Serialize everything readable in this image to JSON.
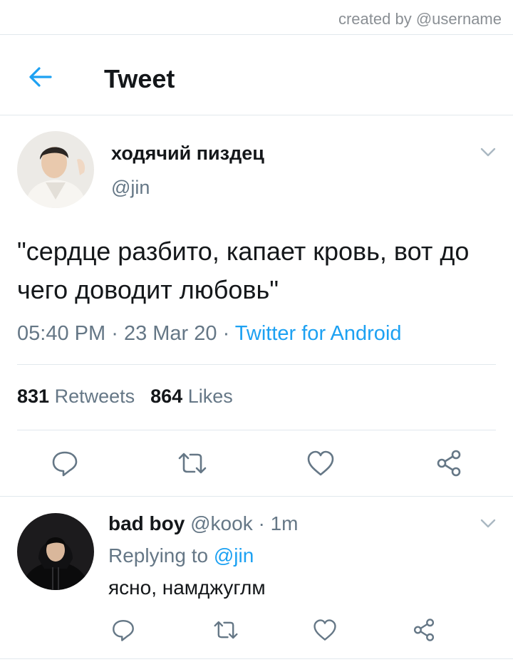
{
  "watermark": "created by @username",
  "header": {
    "title": "Tweet",
    "back_icon": "arrow-left-icon"
  },
  "tweet": {
    "author": {
      "name": "ходячий пиздец",
      "handle": "@jin"
    },
    "text": "\"сердце разбито, капает кровь, вот до чего доводит любовь\"",
    "time": "05:40 PM",
    "date": "23 Mar 20",
    "separator": "·",
    "source": "Twitter for Android",
    "stats": {
      "retweets_count": "831",
      "retweets_label": "Retweets",
      "likes_count": "864",
      "likes_label": "Likes"
    }
  },
  "reply": {
    "author": {
      "name": "bad boy",
      "handle": "@kook"
    },
    "time": "1m",
    "separator": "·",
    "replying_label": "Replying to",
    "replying_handle": "@jin",
    "text": "ясно, намджуглм"
  },
  "colors": {
    "accent": "#1da1f2",
    "muted": "#657786",
    "text": "#14171a",
    "divider": "#e1e8ed"
  },
  "icons": [
    "arrow-left-icon",
    "chevron-down-icon",
    "reply-icon",
    "retweet-icon",
    "like-icon",
    "share-icon"
  ]
}
